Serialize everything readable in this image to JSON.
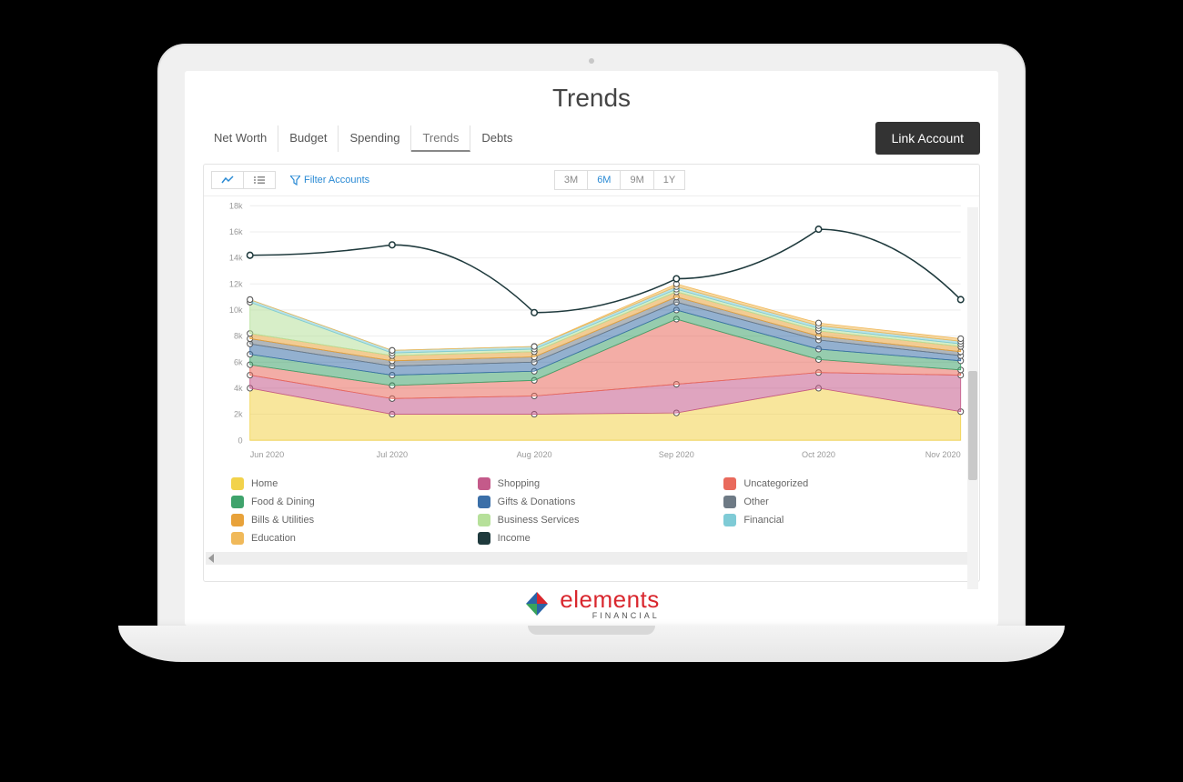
{
  "page_title": "Trends",
  "tabs": [
    "Net Worth",
    "Budget",
    "Spending",
    "Trends",
    "Debts"
  ],
  "active_tab": "Trends",
  "link_account_label": "Link Account",
  "toolbar": {
    "filter_label": "Filter Accounts",
    "ranges": [
      "3M",
      "6M",
      "9M",
      "1Y"
    ],
    "active_range": "6M"
  },
  "legend_series": [
    {
      "name": "Home",
      "color": "#f2d24b"
    },
    {
      "name": "Shopping",
      "color": "#c45a8a"
    },
    {
      "name": "Uncategorized",
      "color": "#e96a5c"
    },
    {
      "name": "Food & Dining",
      "color": "#3fa36c"
    },
    {
      "name": "Gifts & Donations",
      "color": "#3b6fa8"
    },
    {
      "name": "Other",
      "color": "#6e7a85"
    },
    {
      "name": "Bills & Utilities",
      "color": "#e8a23a"
    },
    {
      "name": "Business Services",
      "color": "#b6e09a"
    },
    {
      "name": "Financial",
      "color": "#7fcbd6"
    },
    {
      "name": "Education",
      "color": "#f0b95a"
    },
    {
      "name": "Income",
      "color": "#1f3a3d"
    }
  ],
  "brand": {
    "name": "elements",
    "sub": "FINANCIAL"
  },
  "chart_data": {
    "type": "area",
    "title": "Trends",
    "xlabel": "",
    "ylabel": "",
    "ylim": [
      0,
      18000
    ],
    "y_ticks": [
      0,
      2000,
      4000,
      6000,
      8000,
      10000,
      12000,
      14000,
      16000,
      18000
    ],
    "y_tick_labels": [
      "0",
      "2k",
      "4k",
      "6k",
      "8k",
      "10k",
      "12k",
      "14k",
      "16k",
      "18k"
    ],
    "categories": [
      "Jun 2020",
      "Jul 2020",
      "Aug 2020",
      "Sep 2020",
      "Oct 2020",
      "Nov 2020"
    ],
    "stacked_series": [
      {
        "name": "Home",
        "color": "#f2d24b",
        "values": [
          4000,
          2000,
          2000,
          2100,
          4000,
          2200
        ]
      },
      {
        "name": "Shopping",
        "color": "#c45a8a",
        "values": [
          1000,
          1200,
          1400,
          2200,
          1200,
          2800
        ]
      },
      {
        "name": "Uncategorized",
        "color": "#e96a5c",
        "values": [
          800,
          1000,
          1200,
          5000,
          1000,
          400
        ]
      },
      {
        "name": "Food & Dining",
        "color": "#3fa36c",
        "values": [
          800,
          800,
          700,
          700,
          800,
          700
        ]
      },
      {
        "name": "Gifts & Donations",
        "color": "#3b6fa8",
        "values": [
          800,
          700,
          700,
          600,
          700,
          400
        ]
      },
      {
        "name": "Other",
        "color": "#6e7a85",
        "values": [
          400,
          400,
          400,
          400,
          300,
          300
        ]
      },
      {
        "name": "Bills & Utilities",
        "color": "#e8a23a",
        "values": [
          400,
          400,
          400,
          400,
          400,
          400
        ]
      },
      {
        "name": "Business Services",
        "color": "#b6e09a",
        "values": [
          2400,
          200,
          200,
          200,
          200,
          200
        ]
      },
      {
        "name": "Financial",
        "color": "#7fcbd6",
        "values": [
          200,
          200,
          200,
          200,
          200,
          200
        ]
      },
      {
        "name": "Education",
        "color": "#f0b95a",
        "values": [
          0,
          0,
          0,
          200,
          200,
          200
        ]
      }
    ],
    "line_series": {
      "name": "Income",
      "color": "#1f3a3d",
      "values": [
        14200,
        15000,
        9800,
        12400,
        16200,
        10800
      ]
    }
  }
}
